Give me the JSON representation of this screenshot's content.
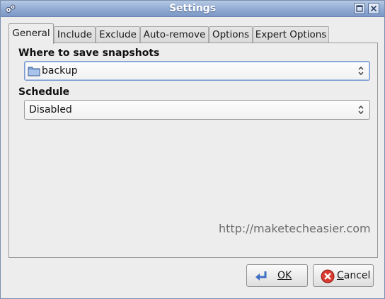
{
  "window": {
    "title": "Settings"
  },
  "tabs": [
    {
      "label": "General",
      "active": true
    },
    {
      "label": "Include",
      "active": false
    },
    {
      "label": "Exclude",
      "active": false
    },
    {
      "label": "Auto-remove",
      "active": false
    },
    {
      "label": "Options",
      "active": false
    },
    {
      "label": "Expert Options",
      "active": false
    }
  ],
  "general": {
    "snapshots_label": "Where to save snapshots",
    "snapshots_value": "backup",
    "schedule_label": "Schedule",
    "schedule_value": "Disabled"
  },
  "watermark": "http://maketecheasier.com",
  "buttons": {
    "ok_label": "OK",
    "cancel_rest": "ancel",
    "cancel_mnemonic": "C"
  },
  "colors": {
    "titlebar": "#90aad2",
    "cancel_icon": "#d93a2e",
    "ok_icon": "#3f6fc4"
  }
}
